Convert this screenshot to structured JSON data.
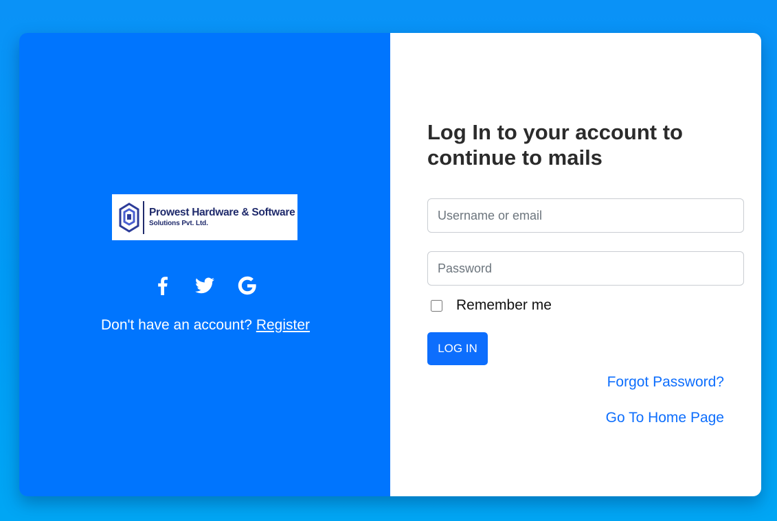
{
  "colors": {
    "background": "#0a92f7",
    "left_panel": "#0075fe",
    "primary": "#0d6efd",
    "text_dark": "#2b2b2b"
  },
  "brand": {
    "logo_line1": "Prowest Hardware & Software",
    "logo_line2": "Solutions Pvt. Ltd."
  },
  "social": {
    "icons": [
      "facebook-icon",
      "twitter-icon",
      "google-icon"
    ]
  },
  "register": {
    "prompt": "Don't have an account?",
    "link": "Register"
  },
  "login": {
    "heading": "Log In to your account to continue to mails",
    "username_placeholder": "Username or email",
    "password_placeholder": "Password",
    "remember_label": "Remember me",
    "submit_label": "LOG IN",
    "forgot_link": "Forgot Password?",
    "home_link": "Go To Home Page"
  }
}
